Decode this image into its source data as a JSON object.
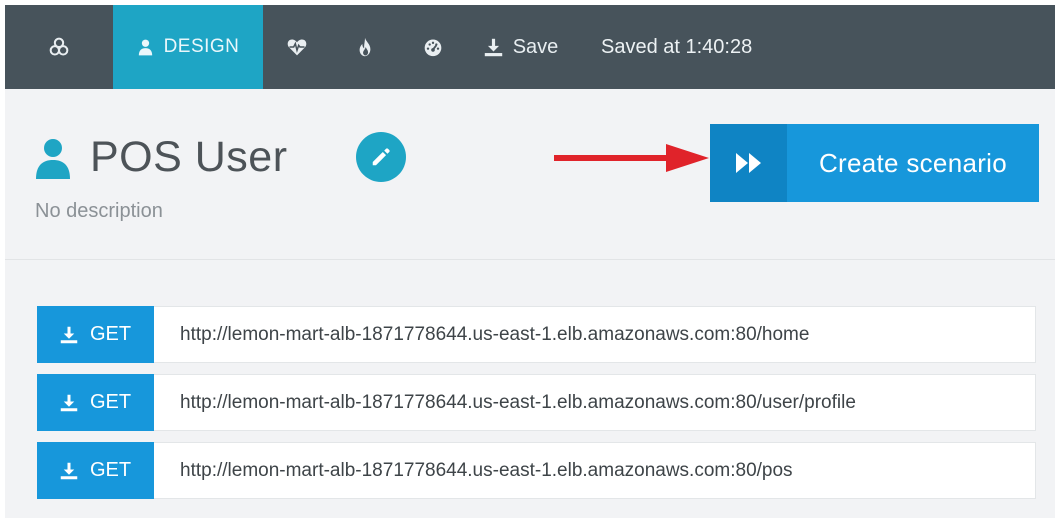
{
  "colors": {
    "topbar_bg": "#47535b",
    "accent_teal": "#1ea5c5",
    "accent_blue": "#1797db",
    "annotation_arrow": "#e0232a"
  },
  "topbar": {
    "icons": [
      "logo-cluster-icon",
      "user-icon",
      "heart-monitor-icon",
      "fire-icon",
      "gauge-icon",
      "download-icon"
    ],
    "design_label": "DESIGN",
    "save_label": "Save",
    "status": "Saved at 1:40:28"
  },
  "header": {
    "title": "POS User",
    "description": "No description",
    "create_label": "Create scenario"
  },
  "requests": [
    {
      "method": "GET",
      "url": "http://lemon-mart-alb-1871778644.us-east-1.elb.amazonaws.com:80/home"
    },
    {
      "method": "GET",
      "url": "http://lemon-mart-alb-1871778644.us-east-1.elb.amazonaws.com:80/user/profile"
    },
    {
      "method": "GET",
      "url": "http://lemon-mart-alb-1871778644.us-east-1.elb.amazonaws.com:80/pos"
    }
  ]
}
